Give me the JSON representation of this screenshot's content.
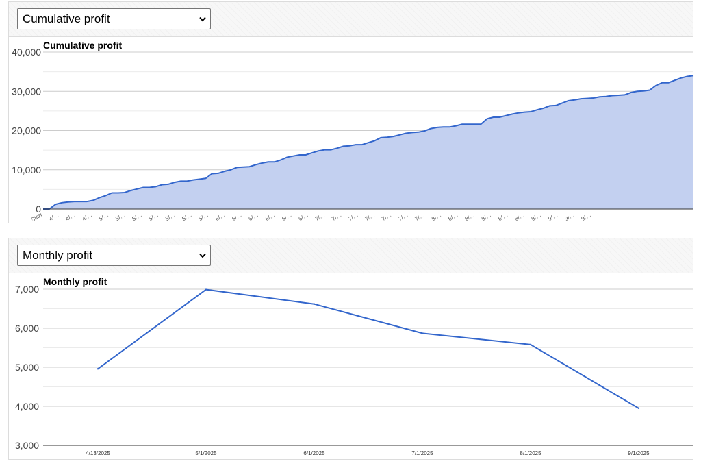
{
  "charts": [
    {
      "select_value": "Cumulative profit",
      "select_options": [
        "Cumulative profit",
        "Monthly profit"
      ]
    },
    {
      "select_value": "Monthly profit",
      "select_options": [
        "Cumulative profit",
        "Monthly profit"
      ]
    }
  ],
  "colors": {
    "series_line": "#3366cc",
    "area_fill": "#c3d0f0",
    "grid": "#cccccc",
    "grid_minor": "#ebebeb"
  },
  "chart_data": [
    {
      "type": "area",
      "title": "Cumulative profit",
      "xlabel": "",
      "ylabel": "",
      "ylim": [
        0,
        40000
      ],
      "yticks": [
        "0",
        "10,000",
        "20,000",
        "30,000",
        "40,000"
      ],
      "xtick_labels": [
        "Start",
        "4/…",
        "4/…",
        "4/…",
        "5/…",
        "5/…",
        "5/…",
        "5/…",
        "5/…",
        "5/…",
        "5/…",
        "6/…",
        "6/…",
        "6/…",
        "6/…",
        "6/…",
        "6/…",
        "7/…",
        "7/…",
        "7/…",
        "7/…",
        "7/…",
        "7/…",
        "7/…",
        "8/…",
        "8/…",
        "8/…",
        "8/…",
        "8/…",
        "8/…",
        "8/…",
        "9/…",
        "9/…",
        "9/…"
      ],
      "grid": true,
      "series": [
        {
          "values": [
            0,
            0,
            1200,
            1600,
            1800,
            1900,
            1900,
            1900,
            2200,
            2900,
            3400,
            4100,
            4100,
            4200,
            4700,
            5100,
            5500,
            5500,
            5700,
            6200,
            6300,
            6800,
            7100,
            7100,
            7400,
            7600,
            7800,
            9000,
            9100,
            9600,
            10000,
            10600,
            10700,
            10800,
            11300,
            11700,
            12000,
            12000,
            12500,
            13200,
            13500,
            13800,
            13800,
            14300,
            14800,
            15100,
            15100,
            15500,
            16000,
            16100,
            16400,
            16400,
            16900,
            17400,
            18200,
            18300,
            18500,
            18900,
            19300,
            19500,
            19600,
            19900,
            20500,
            20800,
            20900,
            20900,
            21200,
            21600,
            21600,
            21600,
            21600,
            23000,
            23400,
            23400,
            23800,
            24200,
            24500,
            24700,
            24800,
            25300,
            25700,
            26300,
            26400,
            27000,
            27600,
            27800,
            28100,
            28200,
            28300,
            28600,
            28700,
            28900,
            29000,
            29100,
            29700,
            30000,
            30100,
            30300,
            31500,
            32200,
            32200,
            32800,
            33400,
            33800,
            34000
          ]
        }
      ]
    },
    {
      "type": "line",
      "title": "Monthly profit",
      "xlabel": "",
      "ylabel": "",
      "ylim": [
        3000,
        7000
      ],
      "yticks": [
        "3,000",
        "4,000",
        "5,000",
        "6,000",
        "7,000"
      ],
      "categories": [
        "4/13/2025",
        "5/1/2025",
        "6/1/2025",
        "7/1/2025",
        "8/1/2025",
        "9/1/2025"
      ],
      "grid": true,
      "series": [
        {
          "values": [
            4960,
            6990,
            6620,
            5870,
            5580,
            3950
          ]
        }
      ]
    }
  ]
}
